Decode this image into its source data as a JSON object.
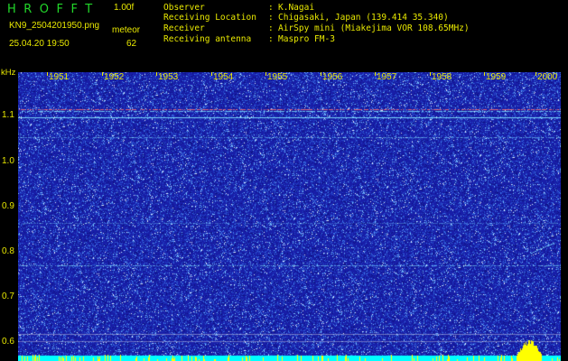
{
  "header": {
    "app_title": "HROFFT",
    "version": "1.00f",
    "filename": "KN9_2504201950.png",
    "mode": "meteor",
    "datetime": "25.04.20 19:50",
    "count": "62",
    "info": [
      {
        "label": "Observer",
        "value": "K.Nagai"
      },
      {
        "label": "Receiving Location",
        "value": "Chigasaki, Japan (139.414 35.340)"
      },
      {
        "label": "Receiver",
        "value": "AirSpy mini (Miakejima VOR 108.65MHz)"
      },
      {
        "label": "Receiving antenna",
        "value": "Maspro FM-3"
      }
    ]
  },
  "spectrogram": {
    "y_unit": "kHz",
    "y_ticks": [
      "1.1",
      "1.0",
      "0.9",
      "0.8",
      "0.7",
      "0.6"
    ],
    "x_ticks": [
      "1951",
      "1952",
      "1953",
      "1954",
      "1955",
      "1956",
      "1957",
      "1958",
      "1959",
      "2000"
    ],
    "colors": {
      "background": "#1a1fa8",
      "noise_bright": "#8fd0ff",
      "line_cyan": "#7fe0ff",
      "line_red": "#ff7070",
      "bottom_yellow": "#ffff00",
      "text": "#e8e800",
      "title_green": "#22d82a"
    }
  }
}
